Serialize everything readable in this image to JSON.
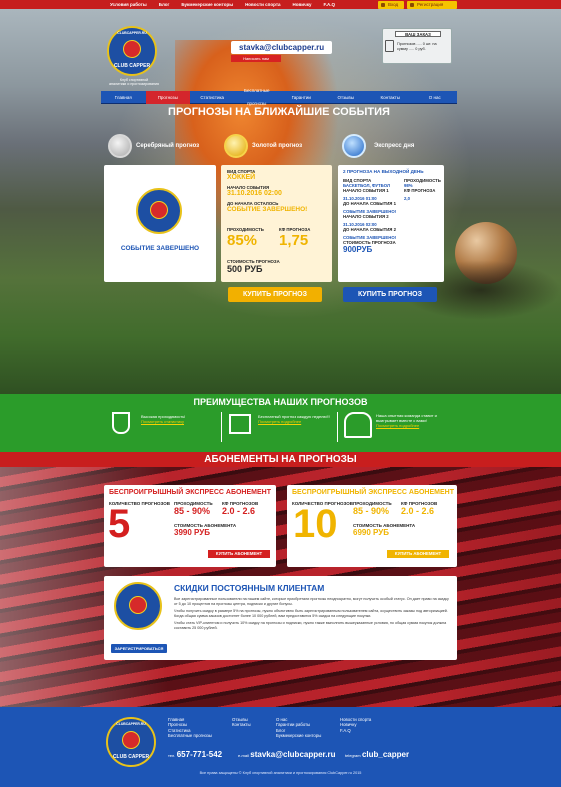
{
  "topnav": [
    "Условия работы",
    "Блог",
    "Букмекерские конторы",
    "Новости спорта",
    "Новичку",
    "F.A.Q"
  ],
  "auth": {
    "login": "Вход",
    "register": "Регистрация"
  },
  "brand": {
    "logo_ring": "CLUBCAPPER.RU",
    "logo_name": "CLUB CAPPER",
    "tagline_1": "Клуб спортивной",
    "tagline_2": "аналитики и прогнозирования"
  },
  "contact": {
    "email": "stavka@clubcapper.ru",
    "call_label": "Написать нам"
  },
  "order": {
    "title": "ВАШ ЗАКАЗ",
    "line1": "Прогнозов ..... 0 шт. на",
    "line2": "сумму ..... 0 руб."
  },
  "mainnav": [
    "Главная",
    "Прогнозы",
    "Статистика",
    "Бесплатные прогнозы",
    "Гарантии",
    "Отзывы",
    "Контакты",
    "О нас"
  ],
  "hero_title": "ПРОГНОЗЫ НА БЛИЖАЙШИЕ СОБЫТИЯ",
  "badges": {
    "silver": "Серебряный прогноз",
    "gold": "Золотой прогноз",
    "express": "Экспресс дня"
  },
  "event_done": "СОБЫТИЕ ЗАВЕРШЕНО",
  "gold_card": {
    "sport_label": "ВИД СПОРТА",
    "sport": "ХОККЕЙ",
    "start_label": "НАЧАЛО СОБЫТИЯ",
    "start": "31.10.2016 02:00",
    "left_label": "ДО НАЧАЛА ОСТАЛОСЬ",
    "left": "СОБЫТИЕ ЗАВЕРШЕНО!",
    "pass_label": "ПРОХОДИМОСТЬ",
    "pass": "85%",
    "coef_label": "КФ ПРОГНОЗА",
    "coef": "1,75",
    "price_label": "СТОИМОСТЬ ПРОГНОЗА",
    "price": "500 РУБ"
  },
  "express_card": {
    "title": "2 ПРОГНОЗА НА ВЫХОДНОЙ ДЕНЬ",
    "sport_label": "ВИД СПОРТА",
    "sport": "БАСКЕТБОЛ, ФУТБОЛ",
    "pass_label": "ПРОХОДИМОСТЬ",
    "pass": "98%",
    "start1_label": "НАЧАЛО СОБЫТИЯ 1",
    "start1": "31.10.2016 01:00",
    "coef_label": "КФ ПРОГНОЗА",
    "coef": "2,0",
    "left1_label": "ДО НАЧАЛА СОБЫТИЯ 1",
    "left1": "СОБЫТИЕ ЗАВЕРШЕНО!",
    "start2_label": "НАЧАЛО СОБЫТИЯ 2",
    "start2": "31.10.2016 02:00",
    "left2_label": "ДО НАЧАЛА СОБЫТИЯ 2",
    "left2": "СОБЫТИЕ ЗАВЕРШЕНО!",
    "price_label": "СТОИМОСТЬ ПРОГНОЗА",
    "price": "900РУБ"
  },
  "buy_label": "КУПИТЬ ПРОГНОЗ",
  "advantages": {
    "title": "ПРЕИМУЩЕСТВА НАШИХ ПРОГНОЗОВ",
    "items": [
      {
        "text": "Высокая проходимость!",
        "link": "Посмотреть статистику"
      },
      {
        "text": "Бесплатный прогноз каждую неделю!!!",
        "link": "Посмотреть подробнее"
      },
      {
        "text": "Наша опытная команда ставит и выигрывает вместе с вами!",
        "link": "Посмотреть подробнее"
      }
    ]
  },
  "subscriptions_title": "АБОНЕМЕНТЫ НА ПРОГНОЗЫ",
  "subs": [
    {
      "title": "БЕСПРОИГРЫШНЫЙ ЭКСПРЕСС АБОНЕМЕНТ",
      "count_label": "КОЛИЧЕСТВО ПРОГНОЗОВ",
      "count": "5",
      "pass_label": "ПРОХОДИМОСТЬ",
      "pass": "85 - 90%",
      "coef_label": "КФ ПРОГНОЗОВ",
      "coef": "2.0 - 2.6",
      "price_label": "СТОИМОСТЬ АБОНЕМЕНТА",
      "price": "3990 РУБ",
      "buy": "КУПИТЬ АБОНЕМЕНТ",
      "color": "#d41f1f"
    },
    {
      "title": "БЕСПРОИГРЫШНЫЙ ЭКСПРЕСС АБОНЕМЕНТ",
      "count_label": "КОЛИЧЕСТВО ПРОГНОЗОВ",
      "count": "10",
      "pass_label": "ПРОХОДИМОСТЬ",
      "pass": "85 - 90%",
      "coef_label": "КФ ПРОГНОЗОВ",
      "coef": "2.0 - 2.6",
      "price_label": "СТОИМОСТЬ АБОНЕМЕНТА",
      "price": "6990 РУБ",
      "buy": "КУПИТЬ АБОНЕМЕНТ",
      "color": "#f0b400"
    }
  ],
  "discounts": {
    "title": "СКИДКИ ПОСТОЯННЫМ КЛИЕНТАМ",
    "p1": "Все зарегистрированные пользователи на нашем сайте, которые приобретали прогнозы неоднократно, могут получить особый статус. Он дает право на скидку от 5 до 10 процентов на прогнозы центра, подписки и другие бонусы.",
    "p2": "Чтобы получить скидку в размере 5% на прогнозы, нужно объективно быть зарегистрированным пользователем сайта, осуществить заказы под авторизацией. Когда общая сумма заказов достигнет более 10 000 рублей, вам предоставится 5% скидка на следующие покупки.",
    "p3": "Чтобы стать VIP-клиентом и получить 10% скидку на прогнозы и подписки, нужно также выполнить вышеуказанные условия, но общая сумма покупок должна составить 25 000 рублей.",
    "register": "ЗАРЕГИСТРИРОВАТЬСЯ"
  },
  "footer": {
    "col1": [
      "Главная",
      "Прогнозы",
      "Статистика",
      "Бесплатные прогнозы"
    ],
    "col2": [
      "Отзывы",
      "Контакты"
    ],
    "col3": [
      "О нас",
      "Гарантии работы",
      "Блог",
      "Букмекерские конторы"
    ],
    "col4": [
      "Новости спорта",
      "Новичку",
      "F.A.Q"
    ],
    "phone_label": "тел.",
    "phone": "657-771-542",
    "email_label": "e-mail",
    "email": "stavka@clubcapper.ru",
    "telegram_label": "telegram",
    "telegram": "club_capper",
    "copyright": "Все права защищены © Клуб спортивной аналитики и прогнозирования ClubCapper.ru 2015"
  }
}
